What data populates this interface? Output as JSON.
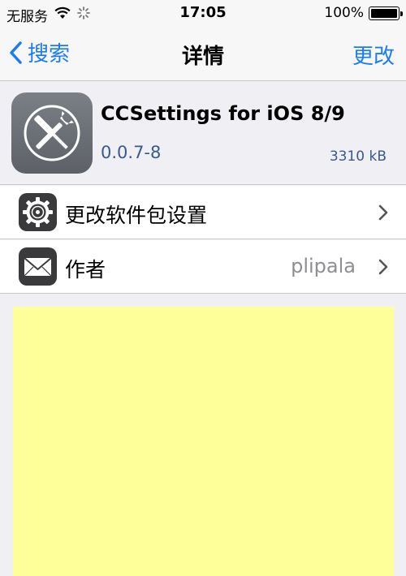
{
  "status_bar": {
    "carrier": "无服务",
    "wifi_icon": "wifi-icon",
    "activity_icon": "activity-spinner-icon",
    "time": "17:05",
    "battery_percent": "100%",
    "battery_level": 1.0
  },
  "nav": {
    "back_label": "搜索",
    "title": "详情",
    "right_label": "更改",
    "accent_color": "#1a7cf5"
  },
  "package": {
    "icon": "tools-icon",
    "name": "CCSettings for iOS 8/9",
    "version": "0.0.7-8",
    "size": "3310 kB"
  },
  "rows": [
    {
      "icon": "gear-icon",
      "label": "更改软件包设置",
      "value": ""
    },
    {
      "icon": "envelope-icon",
      "label": "作者",
      "value": "plipala"
    }
  ],
  "content": {
    "background_color": "#ffff99"
  }
}
